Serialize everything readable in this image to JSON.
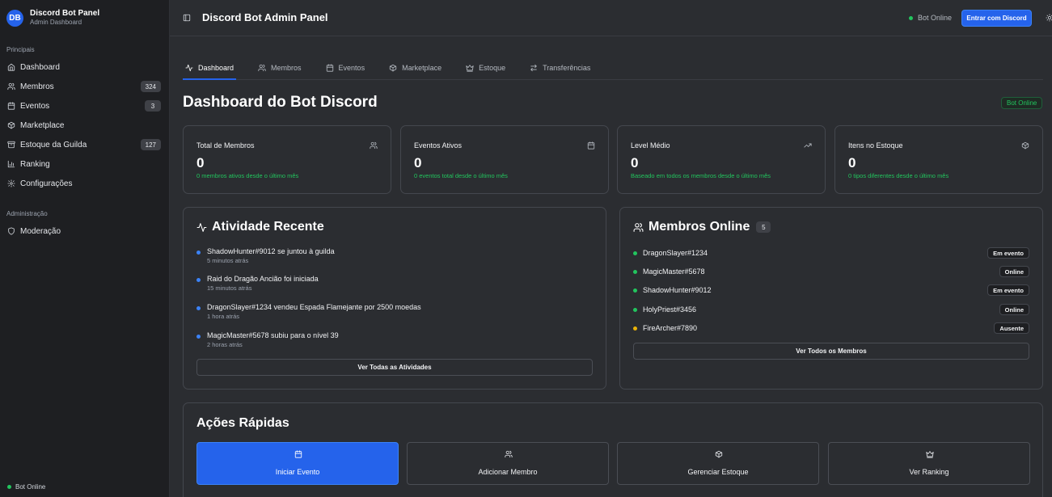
{
  "brand": {
    "initials": "DB",
    "name": "Discord Bot Panel",
    "subtitle": "Admin Dashboard"
  },
  "sidebar": {
    "section_main": "Principais",
    "items": [
      {
        "label": "Dashboard",
        "icon": "home-icon"
      },
      {
        "label": "Membros",
        "icon": "users-icon",
        "badge": "324"
      },
      {
        "label": "Eventos",
        "icon": "calendar-icon",
        "badge": "3"
      },
      {
        "label": "Marketplace",
        "icon": "package-icon"
      },
      {
        "label": "Estoque da Guilda",
        "icon": "archive-icon",
        "badge": "127"
      },
      {
        "label": "Ranking",
        "icon": "bar-chart-icon"
      },
      {
        "label": "Configurações",
        "icon": "gear-icon"
      }
    ],
    "section_admin": "Administração",
    "admin_items": [
      {
        "label": "Moderação",
        "icon": "shield-icon"
      }
    ],
    "status": "Bot Online"
  },
  "header": {
    "title": "Discord Bot Admin Panel",
    "status": "Bot Online",
    "login_label": "Entrar com Discord"
  },
  "tabs": [
    {
      "label": "Dashboard",
      "icon": "activity-icon",
      "active": true
    },
    {
      "label": "Membros",
      "icon": "users-icon"
    },
    {
      "label": "Eventos",
      "icon": "calendar-icon"
    },
    {
      "label": "Marketplace",
      "icon": "package-icon"
    },
    {
      "label": "Estoque",
      "icon": "crown-icon"
    },
    {
      "label": "Transferências",
      "icon": "transfer-icon"
    }
  ],
  "page": {
    "title": "Dashboard do Bot Discord",
    "status_tag": "Bot Online"
  },
  "stats": [
    {
      "label": "Total de Membros",
      "value": "0",
      "desc": "0 membros ativos desde o último mês",
      "icon": "users-icon"
    },
    {
      "label": "Eventos Ativos",
      "value": "0",
      "desc": "0 eventos total desde o último mês",
      "icon": "calendar-icon"
    },
    {
      "label": "Level Médio",
      "value": "0",
      "desc": "Baseado em todos os membros desde o último mês",
      "icon": "trending-up-icon"
    },
    {
      "label": "Itens no Estoque",
      "value": "0",
      "desc": "0 tipos diferentes desde o último mês",
      "icon": "package-icon"
    }
  ],
  "activity": {
    "title": "Atividade Recente",
    "items": [
      {
        "text": "ShadowHunter#9012 se juntou à guilda",
        "time": "5 minutos atrás"
      },
      {
        "text": "Raid do Dragão Ancião foi iniciada",
        "time": "15 minutos atrás"
      },
      {
        "text": "DragonSlayer#1234 vendeu Espada Flamejante por 2500 moedas",
        "time": "1 hora atrás"
      },
      {
        "text": "MagicMaster#5678 subiu para o nível 39",
        "time": "2 horas atrás"
      }
    ],
    "button": "Ver Todas as Atividades"
  },
  "online": {
    "title": "Membros Online",
    "count": "5",
    "members": [
      {
        "name": "DragonSlayer#1234",
        "status": "Em evento",
        "color": "#22c55e"
      },
      {
        "name": "MagicMaster#5678",
        "status": "Online",
        "color": "#22c55e"
      },
      {
        "name": "ShadowHunter#9012",
        "status": "Em evento",
        "color": "#22c55e"
      },
      {
        "name": "HolyPriest#3456",
        "status": "Online",
        "color": "#22c55e"
      },
      {
        "name": "FireArcher#7890",
        "status": "Ausente",
        "color": "#eab308"
      }
    ],
    "button": "Ver Todos os Membros"
  },
  "quick": {
    "title": "Ações Rápidas",
    "actions": [
      {
        "label": "Iniciar Evento",
        "icon": "calendar-icon"
      },
      {
        "label": "Adicionar Membro",
        "icon": "users-icon"
      },
      {
        "label": "Gerenciar Estoque",
        "icon": "package-icon"
      },
      {
        "label": "Ver Ranking",
        "icon": "crown-icon"
      }
    ]
  },
  "colors": {
    "accent": "#2563eb",
    "online": "#22c55e",
    "away": "#eab308"
  }
}
